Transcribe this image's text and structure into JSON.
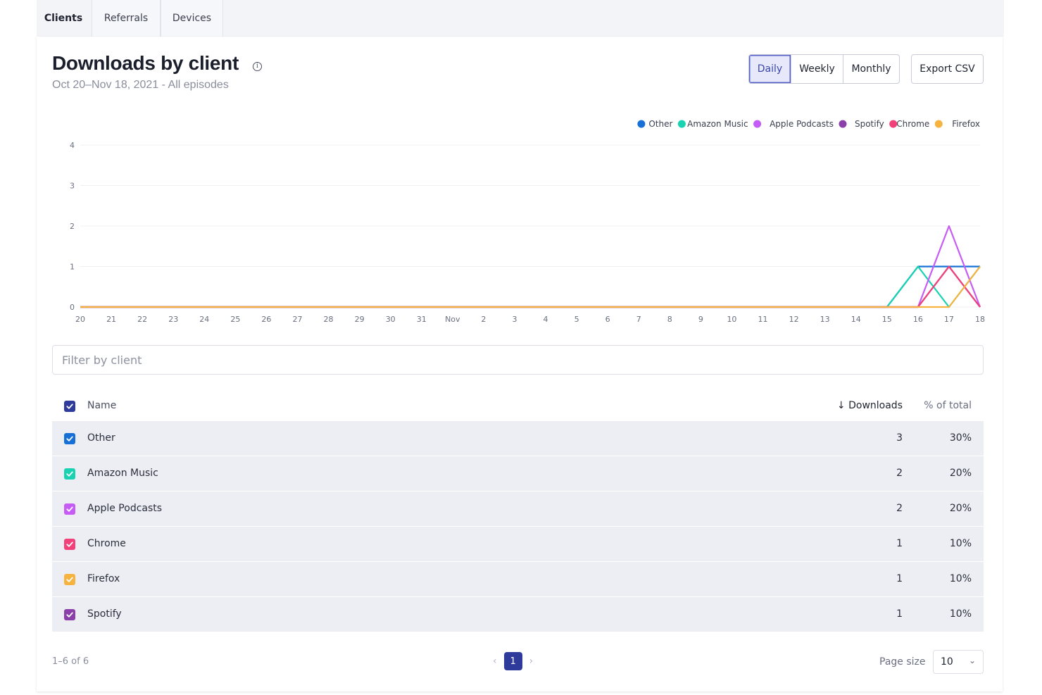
{
  "tabs": [
    {
      "label": "Clients",
      "active": true
    },
    {
      "label": "Referrals",
      "active": false
    },
    {
      "label": "Devices",
      "active": false
    }
  ],
  "header": {
    "title": "Downloads by client",
    "subtitle": "Oct 20–Nov 18, 2021 - All episodes"
  },
  "period": {
    "options": [
      "Daily",
      "Weekly",
      "Monthly"
    ],
    "selected": "Daily"
  },
  "export_label": "Export CSV",
  "chart_data": {
    "type": "line",
    "x": [
      "20",
      "21",
      "22",
      "23",
      "24",
      "25",
      "26",
      "27",
      "28",
      "29",
      "30",
      "31",
      "Nov",
      "2",
      "3",
      "4",
      "5",
      "6",
      "7",
      "8",
      "9",
      "10",
      "11",
      "12",
      "13",
      "14",
      "15",
      "16",
      "17",
      "18"
    ],
    "ylim": [
      0,
      4
    ],
    "yticks": [
      "0",
      "1",
      "2",
      "3",
      "4"
    ],
    "grid": true,
    "legend_position": "top-right",
    "series": [
      {
        "name": "Other",
        "color": "#1670d6",
        "values": [
          0,
          0,
          0,
          0,
          0,
          0,
          0,
          0,
          0,
          0,
          0,
          0,
          0,
          0,
          0,
          0,
          0,
          0,
          0,
          0,
          0,
          0,
          0,
          0,
          0,
          0,
          0,
          1,
          1,
          1
        ]
      },
      {
        "name": "Amazon Music",
        "color": "#18d2b2",
        "values": [
          0,
          0,
          0,
          0,
          0,
          0,
          0,
          0,
          0,
          0,
          0,
          0,
          0,
          0,
          0,
          0,
          0,
          0,
          0,
          0,
          0,
          0,
          0,
          0,
          0,
          0,
          0,
          1,
          0,
          1
        ]
      },
      {
        "name": "Apple Podcasts",
        "color": "#c65cf5",
        "values": [
          0,
          0,
          0,
          0,
          0,
          0,
          0,
          0,
          0,
          0,
          0,
          0,
          0,
          0,
          0,
          0,
          0,
          0,
          0,
          0,
          0,
          0,
          0,
          0,
          0,
          0,
          0,
          0,
          2,
          0
        ]
      },
      {
        "name": "Spotify",
        "color": "#8b3fa8",
        "values": [
          0,
          0,
          0,
          0,
          0,
          0,
          0,
          0,
          0,
          0,
          0,
          0,
          0,
          0,
          0,
          0,
          0,
          0,
          0,
          0,
          0,
          0,
          0,
          0,
          0,
          0,
          0,
          0,
          1,
          0
        ]
      },
      {
        "name": "Chrome",
        "color": "#f2407a",
        "values": [
          0,
          0,
          0,
          0,
          0,
          0,
          0,
          0,
          0,
          0,
          0,
          0,
          0,
          0,
          0,
          0,
          0,
          0,
          0,
          0,
          0,
          0,
          0,
          0,
          0,
          0,
          0,
          0,
          1,
          0
        ]
      },
      {
        "name": "Firefox",
        "color": "#f7b340",
        "values": [
          0,
          0,
          0,
          0,
          0,
          0,
          0,
          0,
          0,
          0,
          0,
          0,
          0,
          0,
          0,
          0,
          0,
          0,
          0,
          0,
          0,
          0,
          0,
          0,
          0,
          0,
          0,
          0,
          0,
          1
        ]
      }
    ]
  },
  "filter": {
    "placeholder": "Filter by client"
  },
  "table": {
    "header_checkbox_color": "#2f3b9b",
    "columns": {
      "name": "Name",
      "downloads": "↓ Downloads",
      "pct": "% of total"
    },
    "rows": [
      {
        "name": "Other",
        "downloads": "3",
        "pct": "30%",
        "color": "#1670d6"
      },
      {
        "name": "Amazon Music",
        "downloads": "2",
        "pct": "20%",
        "color": "#18d2b2"
      },
      {
        "name": "Apple Podcasts",
        "downloads": "2",
        "pct": "20%",
        "color": "#c65cf5"
      },
      {
        "name": "Chrome",
        "downloads": "1",
        "pct": "10%",
        "color": "#f2407a"
      },
      {
        "name": "Firefox",
        "downloads": "1",
        "pct": "10%",
        "color": "#f7b340"
      },
      {
        "name": "Spotify",
        "downloads": "1",
        "pct": "10%",
        "color": "#8b3fa8"
      }
    ]
  },
  "footer": {
    "count": "1–6 of 6",
    "current_page": "1",
    "page_size_label": "Page size",
    "page_size": "10"
  }
}
